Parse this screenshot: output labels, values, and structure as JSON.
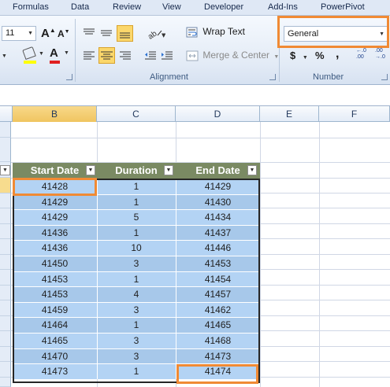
{
  "ribbon": {
    "tabs": [
      "Formulas",
      "Data",
      "Review",
      "View",
      "Developer",
      "Add-Ins",
      "PowerPivot"
    ],
    "font_size": "11",
    "wrap_text_label": "Wrap Text",
    "merge_center_label": "Merge & Center",
    "number_format": "General",
    "alignment_group": "Alignment",
    "number_group": "Number",
    "currency_symbol": "$",
    "percent_symbol": "%",
    "comma_symbol": ",",
    "increase_decimal": "←.0 .00",
    "decrease_decimal": ".00 →.0"
  },
  "columns": [
    "B",
    "C",
    "D",
    "E",
    "F"
  ],
  "table": {
    "headers": [
      "Start Date",
      "Duration",
      "End Date"
    ],
    "rows": [
      [
        "41428",
        "1",
        "41429"
      ],
      [
        "41429",
        "1",
        "41430"
      ],
      [
        "41429",
        "5",
        "41434"
      ],
      [
        "41436",
        "1",
        "41437"
      ],
      [
        "41436",
        "10",
        "41446"
      ],
      [
        "41450",
        "3",
        "41453"
      ],
      [
        "41453",
        "1",
        "41454"
      ],
      [
        "41453",
        "4",
        "41457"
      ],
      [
        "41459",
        "3",
        "41462"
      ],
      [
        "41464",
        "1",
        "41465"
      ],
      [
        "41465",
        "3",
        "41468"
      ],
      [
        "41470",
        "3",
        "41473"
      ],
      [
        "41473",
        "1",
        "41474"
      ]
    ]
  },
  "colors": {
    "accent_highlight": "#f08a34",
    "table_header": "#7a8a63",
    "table_row": "#b3d3f4"
  }
}
